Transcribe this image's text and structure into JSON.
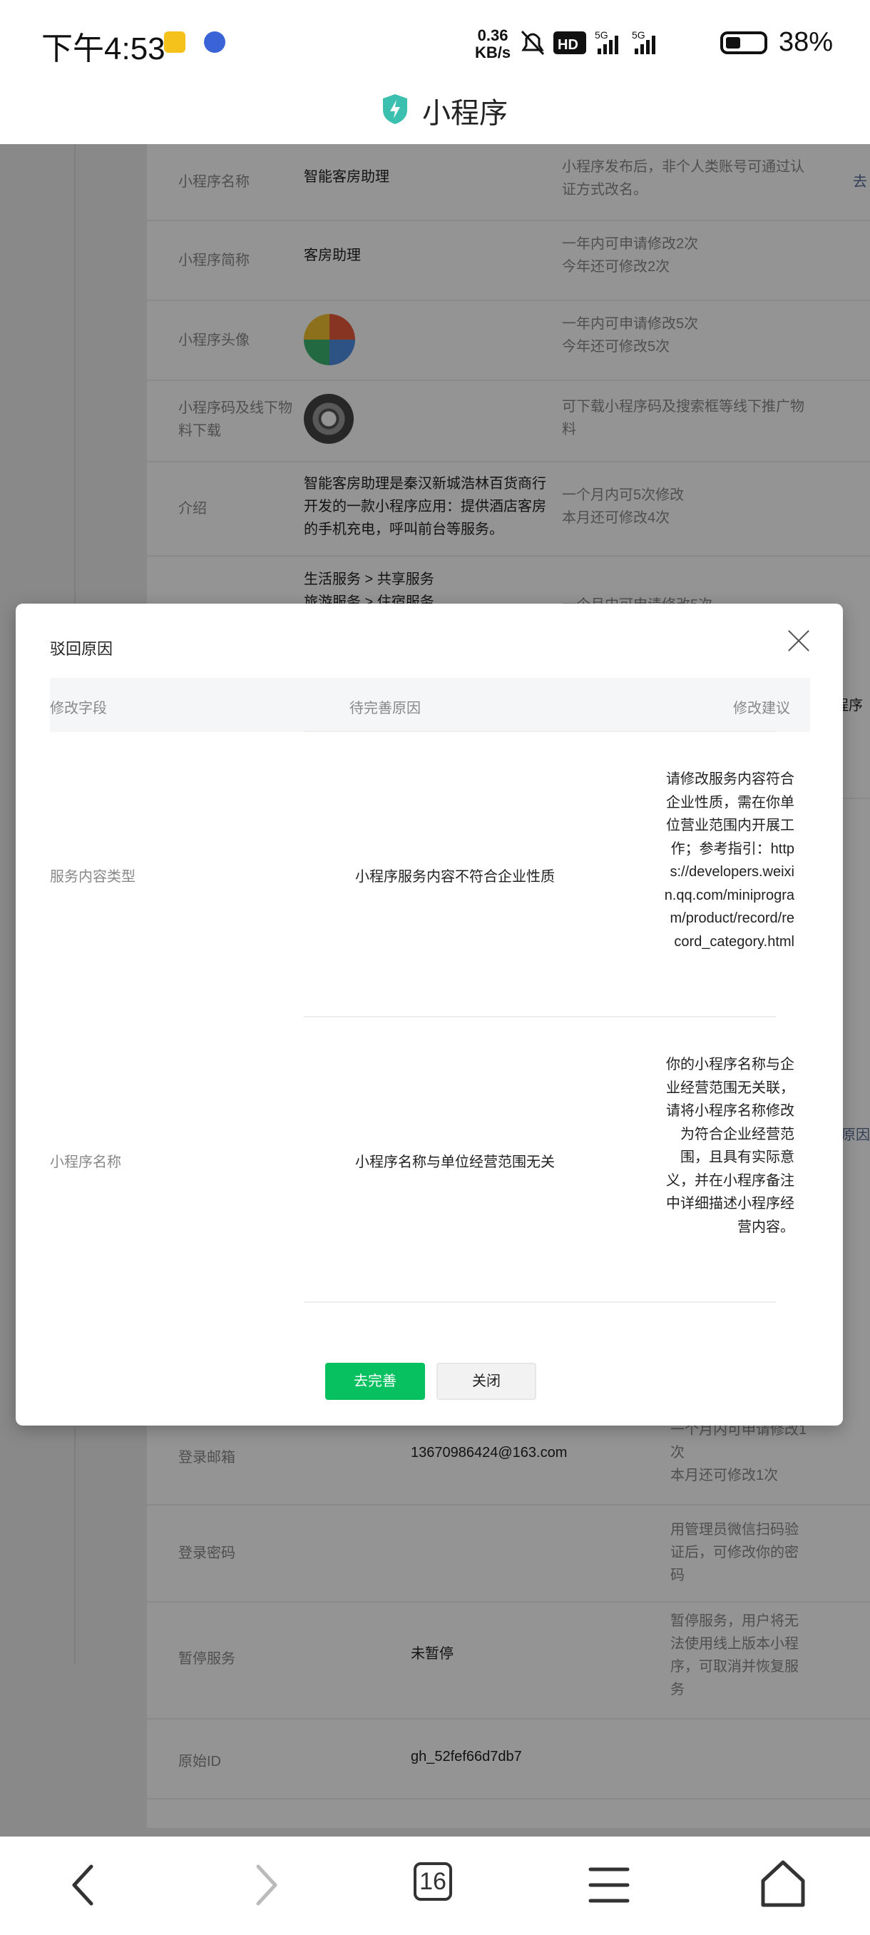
{
  "status_bar": {
    "time": "下午4:53",
    "net_speed_value": "0.36",
    "net_speed_unit": "KB/s",
    "battery": "38%",
    "icons": [
      "mute-icon",
      "hd-icon",
      "signal-5g-icon",
      "signal-5g-icon",
      "battery-icon"
    ]
  },
  "header": {
    "title": "小程序"
  },
  "background_rows": [
    {
      "label": "小程序名称",
      "value": "智能客房助理",
      "note": "小程序发布后，非个人类账号可通过认证方式改名。",
      "link": "去"
    },
    {
      "label": "小程序简称",
      "value": "客房助理",
      "note": "一年内可申请修改2次\n今年还可修改2次"
    },
    {
      "label": "小程序头像",
      "note": "一年内可申请修改5次\n今年还可修改5次"
    },
    {
      "label": "小程序码及线下物料下载",
      "note": "可下载小程序码及搜索框等线下推广物料"
    },
    {
      "label": "介绍",
      "value": "智能客房助理是秦汉新城浩林百货商行开发的一款小程序应用：提供酒店客房的手机充电，呼叫前台等服务。",
      "note": "一个月内可5次修改\n本月还可修改4次"
    },
    {
      "value": "生活服务 > 共享服务\n旅游服务 > 住宿服务",
      "note": "一个月内可申请修改5次"
    },
    {
      "label": "登录邮箱",
      "value": "13670986424@163.com",
      "note": "一个月内可申请修改1次\n本月还可修改1次"
    },
    {
      "label": "登录密码",
      "note": "用管理员微信扫码验证后，可修改你的密码"
    },
    {
      "label": "暂停服务",
      "value": "未暂停",
      "note": "暂停服务，用户将无法使用线上版本小程序，可取消并恢复服务"
    },
    {
      "label": "原始ID",
      "value": "gh_52fef66d7db7"
    }
  ],
  "background_side_fragments": [
    "程序",
    "原因"
  ],
  "modal": {
    "title": "驳回原因",
    "columns": {
      "field": "修改字段",
      "reason": "待完善原因",
      "suggestion": "修改建议"
    },
    "rows": [
      {
        "field": "服务内容类型",
        "reason": "小程序服务内容不符合企业性质",
        "suggestion": "请修改服务内容符合企业性质，需在你单位营业范围内开展工作；参考指引：https://developers.weixin.qq.com/miniprogram/product/record/record_category.html"
      },
      {
        "field": "小程序名称",
        "reason": "小程序名称与单位经营范围无关",
        "suggestion": "你的小程序名称与企业经营范围无关联，请将小程序名称修改为符合企业经营范围，且具有实际意义，并在小程序备注中详细描述小程序经营内容。"
      }
    ],
    "primary_button": "去完善",
    "secondary_button": "关闭"
  },
  "nav_bar": {
    "tab_count": "16"
  },
  "colors": {
    "primary": "#07c160",
    "dim_overlay": "rgba(0,0,0,0.42)",
    "shield": "#3bbfae"
  }
}
